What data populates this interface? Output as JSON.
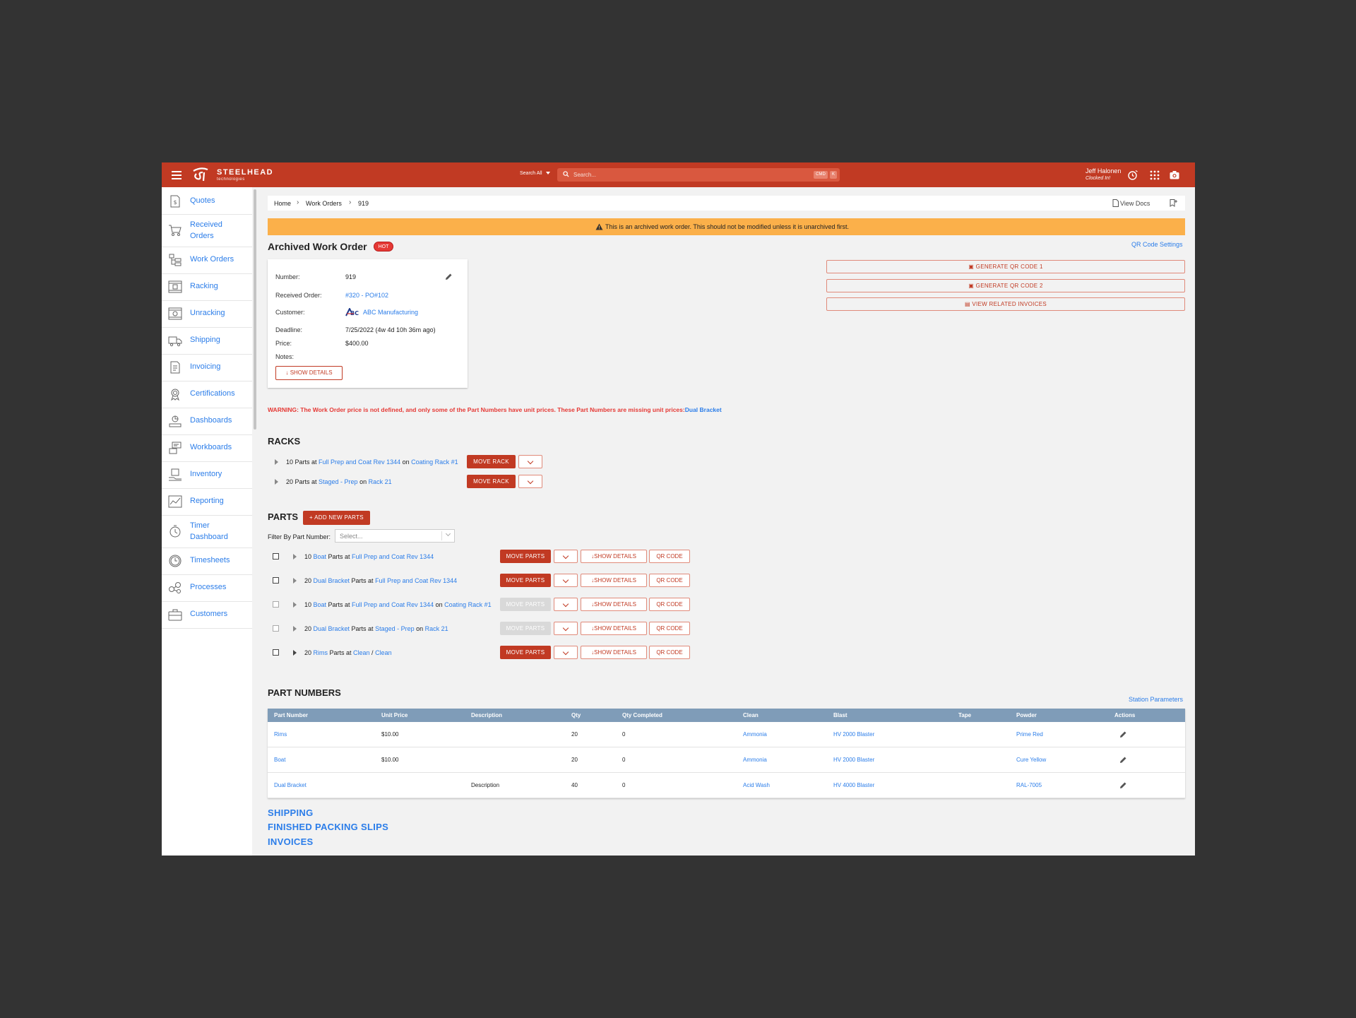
{
  "header": {
    "brand": "STEELHEAD",
    "brand_sub": "technologies",
    "search_scope": "Search All",
    "search_placeholder": "Search...",
    "kbd_cmd": "CMD",
    "kbd_k": "K",
    "user_name": "Jeff Halonen",
    "user_status": "Clocked In!"
  },
  "sidebar": {
    "items": [
      {
        "label": "Quotes",
        "icon": "dollar-doc-icon"
      },
      {
        "label": "Received\nOrders",
        "icon": "cart-icon"
      },
      {
        "label": "Work Orders",
        "icon": "work-orders-icon"
      },
      {
        "label": "Racking",
        "icon": "rack-icon"
      },
      {
        "label": "Unracking",
        "icon": "unrack-icon"
      },
      {
        "label": "Shipping",
        "icon": "truck-icon"
      },
      {
        "label": "Invoicing",
        "icon": "invoice-icon"
      },
      {
        "label": "Certifications",
        "icon": "certificate-icon"
      },
      {
        "label": "Dashboards",
        "icon": "dashboard-icon"
      },
      {
        "label": "Workboards",
        "icon": "workboard-icon"
      },
      {
        "label": "Inventory",
        "icon": "inventory-icon"
      },
      {
        "label": "Reporting",
        "icon": "chart-icon"
      },
      {
        "label": "Timer\nDashboard",
        "icon": "timer-icon"
      },
      {
        "label": "Timesheets",
        "icon": "clock-icon"
      },
      {
        "label": "Processes",
        "icon": "process-icon"
      },
      {
        "label": "Customers",
        "icon": "briefcase-icon"
      }
    ]
  },
  "breadcrumb": {
    "home": "Home",
    "work_orders": "Work Orders",
    "current": "919",
    "view_docs": "View Docs"
  },
  "banner": "This is an archived work order. This should not be modified unless it is unarchived first.",
  "title": "Archived Work Order",
  "hot_badge": "HOT",
  "qr_settings": "QR Code Settings",
  "details": {
    "number_label": "Number:",
    "number": "919",
    "received_label": "Received Order:",
    "received": "#320 - PO#102",
    "customer_label": "Customer:",
    "customer": "ABC Manufacturing",
    "deadline_label": "Deadline:",
    "deadline": "7/25/2022 (4w 4d 10h 36m ago)",
    "price_label": "Price:",
    "price": "$400.00",
    "notes_label": "Notes:",
    "show_details": "SHOW DETAILS"
  },
  "actions": {
    "qr1": "GENERATE QR CODE 1",
    "qr2": "GENERATE QR CODE 2",
    "invoices": "VIEW RELATED INVOICES"
  },
  "warning": {
    "text": "WARNING: The Work Order price is not defined, and only some of the Part Numbers have unit prices. These Part Numbers are missing unit prices:",
    "link": "Dual Bracket"
  },
  "racks": {
    "title": "RACKS",
    "move_label": "MOVE RACK",
    "rows": [
      {
        "qty": "10 Parts at ",
        "process": "Full Prep and Coat Rev 1344",
        "on": " on ",
        "rack": "Coating Rack #1"
      },
      {
        "qty": "20 Parts at ",
        "process": "Staged - Prep",
        "on": " on ",
        "rack": "Rack 21"
      }
    ]
  },
  "parts": {
    "title": "PARTS",
    "add_label": "+ ADD NEW PARTS",
    "filter_label": "Filter By Part Number:",
    "filter_placeholder": "Select...",
    "move_label": "MOVE PARTS",
    "show_label": "SHOW DETAILS",
    "qr_label": "QR CODE",
    "rows": [
      {
        "qty": "10 ",
        "part": "Boat",
        "mid": " Parts at ",
        "process": "Full Prep and Coat Rev 1344",
        "on": "",
        "rack": ""
      },
      {
        "qty": "20 ",
        "part": "Dual Bracket",
        "mid": " Parts at ",
        "process": "Full Prep and Coat Rev 1344",
        "on": "",
        "rack": ""
      },
      {
        "qty": "10 ",
        "part": "Boat",
        "mid": " Parts at ",
        "process": "Full Prep and Coat Rev 1344",
        "on": " on ",
        "rack": "Coating Rack #1"
      },
      {
        "qty": "20 ",
        "part": "Dual Bracket",
        "mid": " Parts at ",
        "process": "Staged - Prep",
        "on": " on ",
        "rack": "Rack 21"
      },
      {
        "qty": "20 ",
        "part": "Rims",
        "mid": " Parts at ",
        "process": "Clean",
        "on": " / ",
        "rack": "Clean"
      }
    ]
  },
  "part_numbers": {
    "title": "PART NUMBERS",
    "station_params": "Station Parameters",
    "columns": [
      "Part Number",
      "Unit Price",
      "Description",
      "Qty",
      "Qty Completed",
      "Clean",
      "Blast",
      "Tape",
      "Powder",
      "Actions"
    ],
    "rows": [
      {
        "part": "Rims",
        "price": "$10.00",
        "desc": "",
        "qty": "20",
        "done": "0",
        "clean": "Ammonia",
        "blast": "HV 2000 Blaster",
        "tape": "",
        "powder": "Prime Red"
      },
      {
        "part": "Boat",
        "price": "$10.00",
        "desc": "",
        "qty": "20",
        "done": "0",
        "clean": "Ammonia",
        "blast": "HV 2000 Blaster",
        "tape": "",
        "powder": "Cure Yellow"
      },
      {
        "part": "Dual Bracket",
        "price": "",
        "desc": "Description",
        "qty": "40",
        "done": "0",
        "clean": "Acid Wash",
        "blast": "HV 4000 Blaster",
        "tape": "",
        "powder": "RAL-7005"
      }
    ]
  },
  "sections": {
    "shipping": "SHIPPING",
    "packing": "FINISHED PACKING SLIPS",
    "invoices": "INVOICES"
  },
  "colors": {
    "brand": "#c13a23",
    "link": "#2b7de9",
    "banner": "#fbb04a",
    "table_header": "#7f9cb8",
    "warning": "#e53935"
  }
}
